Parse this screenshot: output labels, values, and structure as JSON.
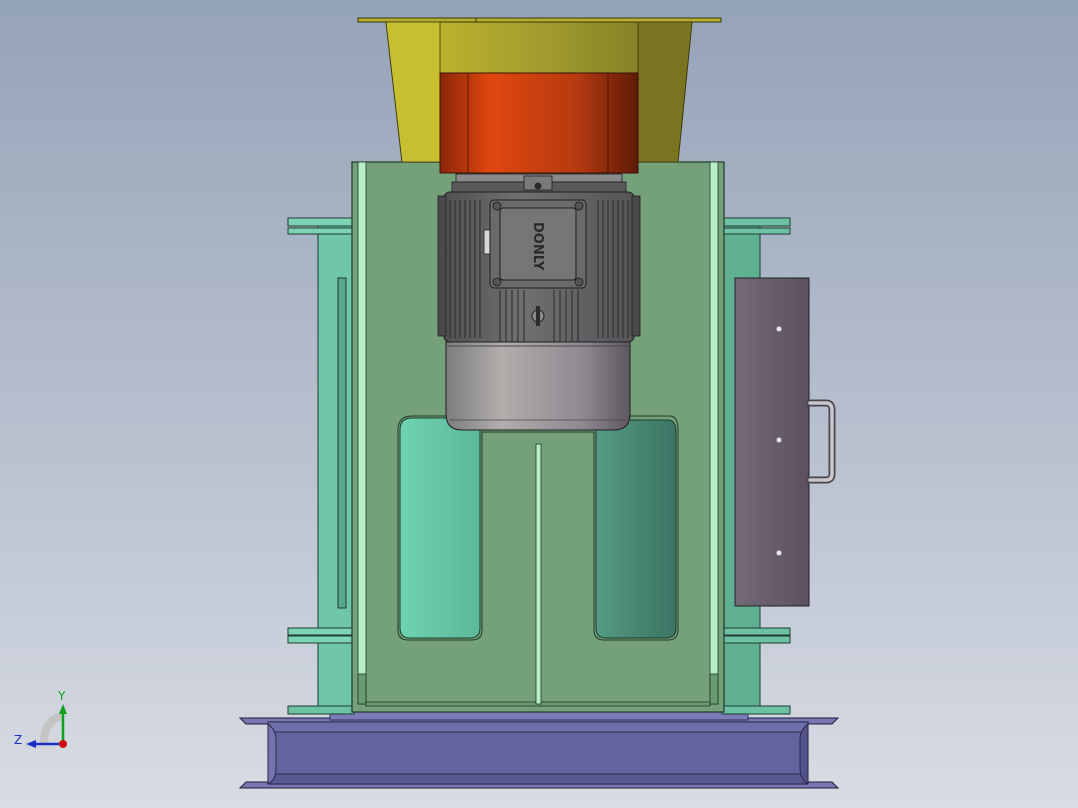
{
  "viewport": {
    "background_top": "#95a3b8",
    "background_bottom": "#d8dce4"
  },
  "model": {
    "motor": {
      "brand_label": "DONLY",
      "body_color": "#6e6d6f",
      "fan_cover_color": "#a9a6a6"
    },
    "hopper": {
      "color": "#a8a12a"
    },
    "reducer": {
      "color": "#c9420f"
    },
    "housing": {
      "color": "#74a07a",
      "side_color": "#6fc6a8"
    },
    "base": {
      "color": "#63629a"
    },
    "side_door": {
      "color": "#6a6070"
    }
  },
  "triad": {
    "y_label": "Y",
    "z_label": "Z",
    "y_icon": "arrow-up-icon",
    "z_icon": "arrow-left-icon"
  }
}
